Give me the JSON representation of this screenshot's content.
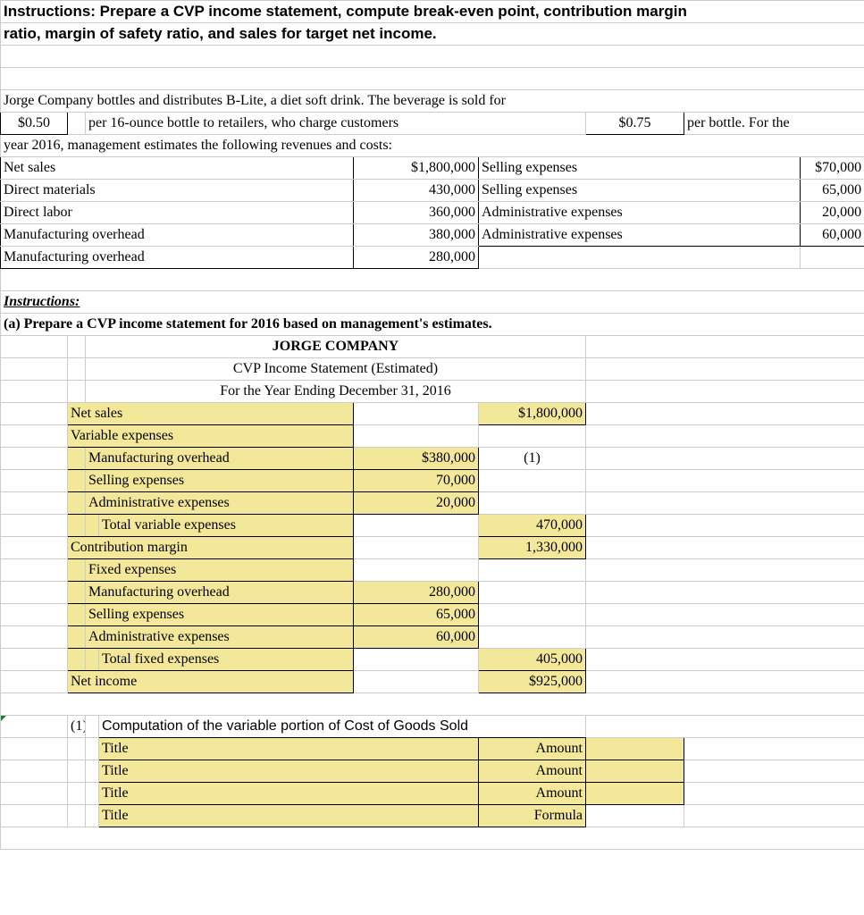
{
  "header": {
    "line1": "Instructions: Prepare a CVP income statement, compute break-even point, contribution margin",
    "line2": "ratio, margin of safety ratio, and sales for target net income."
  },
  "problem": {
    "intro": "Jorge Company bottles and distributes B-Lite, a diet soft drink. The beverage is sold for",
    "price1": "$0.50",
    "mid": "per 16-ounce bottle to retailers, who charge customers",
    "price2": "$0.75",
    "tail": "per bottle. For the",
    "year_line": "year 2016, management estimates the following revenues and costs:"
  },
  "data_table": {
    "rows": [
      {
        "left": "Net sales",
        "lval": "$1,800,000",
        "right": "Selling expenses",
        "rval": "$70,000"
      },
      {
        "left": "Direct materials",
        "lval": "430,000",
        "right": "Selling expenses",
        "rval": "65,000"
      },
      {
        "left": "Direct labor",
        "lval": "360,000",
        "right": "Administrative expenses",
        "rval": "20,000"
      },
      {
        "left": "Manufacturing overhead",
        "lval": "380,000",
        "right": "Administrative expenses",
        "rval": "60,000"
      },
      {
        "left": "Manufacturing overhead",
        "lval": "280,000",
        "right": "",
        "rval": ""
      }
    ]
  },
  "instructions_label": "Instructions:",
  "part_a": "(a) Prepare a CVP income statement for 2016 based on management's estimates.",
  "cvp": {
    "company": "JORGE COMPANY",
    "title": "CVP Income Statement (Estimated)",
    "period": "For the Year Ending December 31, 2016",
    "net_sales": "Net sales",
    "net_sales_val": "$1,800,000",
    "var_exp": "Variable expenses",
    "lines1": [
      {
        "label": "Manufacturing overhead",
        "v1": "$380,000",
        "note": "(1)"
      },
      {
        "label": "Selling expenses",
        "v1": "70,000",
        "note": ""
      },
      {
        "label": "Administrative expenses",
        "v1": "20,000",
        "note": ""
      }
    ],
    "total_var": "Total variable expenses",
    "total_var_val": "470,000",
    "contrib": "Contribution margin",
    "contrib_val": "1,330,000",
    "fixed_exp": "Fixed expenses",
    "lines2": [
      {
        "label": "Manufacturing overhead",
        "v1": "280,000"
      },
      {
        "label": "Selling expenses",
        "v1": "65,000"
      },
      {
        "label": "Administrative expenses",
        "v1": "60,000"
      }
    ],
    "total_fixed": "Total fixed expenses",
    "total_fixed_val": "405,000",
    "net_income": "Net income",
    "net_income_val": "$925,000"
  },
  "comp": {
    "ref": "(1)",
    "heading": "Computation of the variable portion of Cost of Goods Sold",
    "rows": [
      {
        "l": "Title",
        "r": "Amount"
      },
      {
        "l": "Title",
        "r": "Amount"
      },
      {
        "l": "Title",
        "r": "Amount"
      },
      {
        "l": "Title",
        "r": "Formula"
      }
    ]
  }
}
